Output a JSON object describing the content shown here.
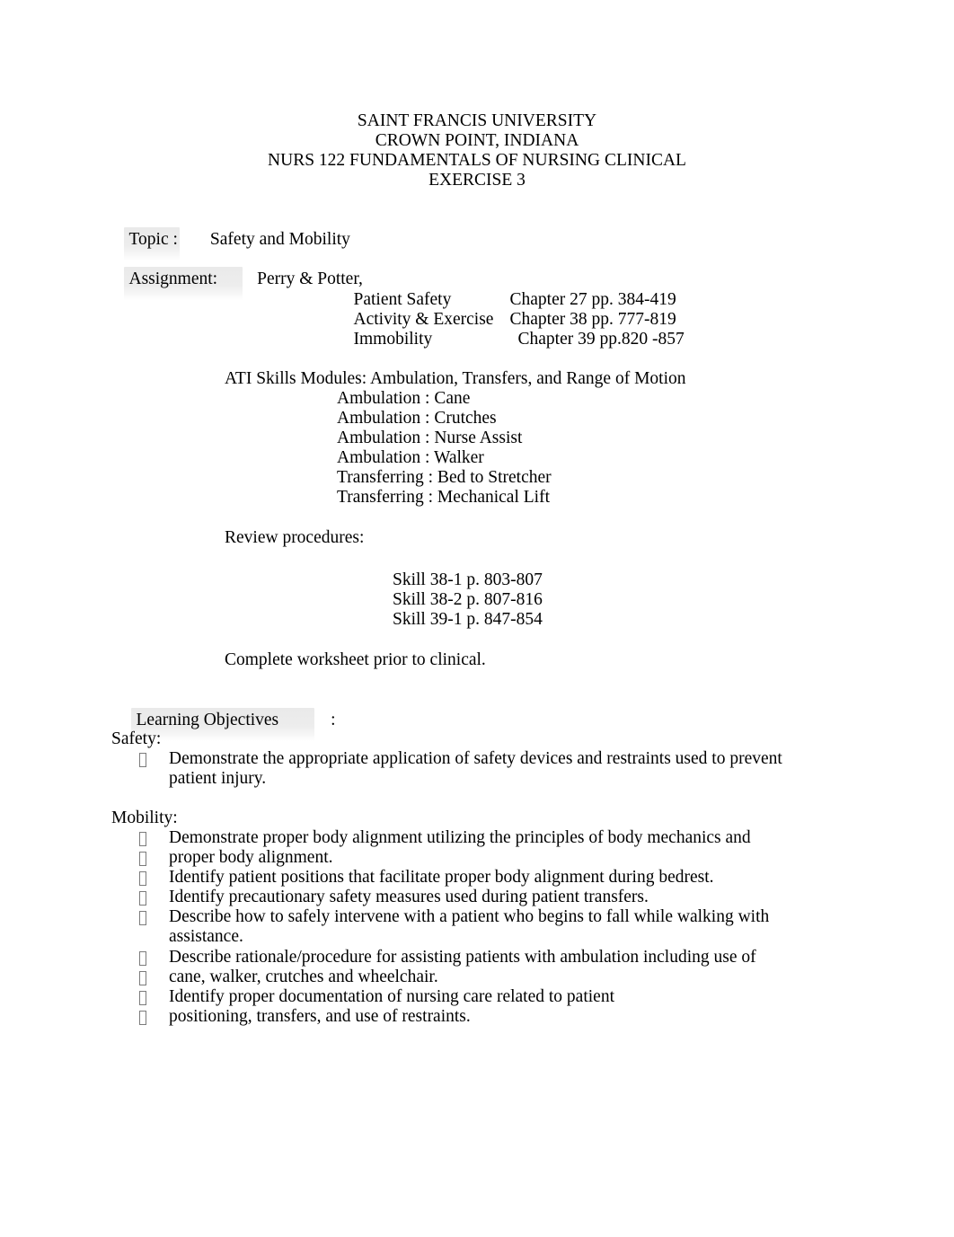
{
  "document": {
    "header": {
      "line1": "SAINT FRANCIS UNIVERSITY",
      "line2": "CROWN POINT, INDIANA",
      "line3": "NURS 122 FUNDAMENTALS OF NURSING CLINICAL",
      "line4": "EXERCISE 3"
    },
    "topic": {
      "label": "Topic :",
      "value": "Safety and Mobility"
    },
    "assignment": {
      "label": "Assignment:",
      "value": "Perry & Potter,",
      "readings": [
        {
          "title": "Patient Safety",
          "reference": "Chapter 27 pp. 384-419"
        },
        {
          "title": "Activity & Exercise",
          "reference": "Chapter 38 pp. 777-819"
        },
        {
          "title": "Immobility",
          "reference": "Chapter 39 pp.820 -857"
        }
      ],
      "ati_heading": "ATI Skills Modules: Ambulation, Transfers, and Range of Motion",
      "ati_modules": [
        "Ambulation : Cane",
        "Ambulation : Crutches",
        "Ambulation : Nurse Assist",
        "Ambulation : Walker",
        "Transferring : Bed to Stretcher",
        "Transferring : Mechanical Lift"
      ],
      "review_heading": "Review procedures:",
      "skills": [
        "Skill 38-1 p. 803-807",
        "Skill 38-2 p. 807-816",
        "Skill 39-1 p. 847-854"
      ],
      "worksheet_note": "Complete worksheet prior to clinical."
    },
    "learning_objectives": {
      "heading": "Learning Objectives",
      "heading_colon": ":",
      "safety": {
        "label": "Safety:",
        "items": [
          {
            "text": "Demonstrate the appropriate application of safety devices and restraints used to prevent",
            "continuation": "patient injury."
          }
        ]
      },
      "mobility": {
        "label": "Mobility:",
        "items": [
          {
            "text": "Demonstrate proper body alignment utilizing the principles of body mechanics and",
            "continuation": null
          },
          {
            "text": "proper body alignment.",
            "continuation": null
          },
          {
            "text": "Identify patient positions that facilitate proper body alignment during bedrest.",
            "continuation": null
          },
          {
            "text": "Identify precautionary safety measures used during patient transfers.",
            "continuation": null
          },
          {
            "text": "Describe how to safely intervene with a patient who begins to fall while walking with",
            "continuation": "assistance."
          },
          {
            "text": "Describe rationale/procedure for assisting patients with ambulation including use of",
            "continuation": null
          },
          {
            "text": "cane, walker, crutches and wheelchair.",
            "continuation": null
          },
          {
            "text": "Identify proper documentation of nursing care related to patient",
            "continuation": null
          },
          {
            "text": "positioning, transfers, and use of restraints.",
            "continuation": null
          }
        ]
      }
    },
    "colors": {
      "text": "#000000",
      "page_background": "#ffffff",
      "field_shading": "#ececec",
      "bullet_glyph": "#7b7b7b"
    }
  }
}
